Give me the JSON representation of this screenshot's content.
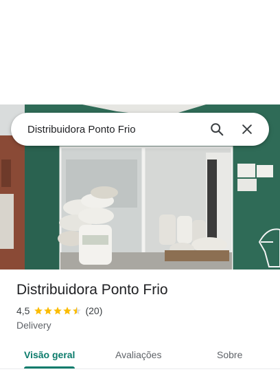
{
  "search": {
    "query": "Distribuidora Ponto Frio"
  },
  "place": {
    "name": "Distribuidora Ponto Frio",
    "rating": "4,5",
    "rating_value": 4.5,
    "reviews": "(20)",
    "category": "Delivery"
  },
  "tabs": [
    {
      "label": "Visão geral",
      "active": true
    },
    {
      "label": "Avaliações",
      "active": false
    },
    {
      "label": "Sobre",
      "active": false
    }
  ],
  "colors": {
    "accent": "#0b7b6b",
    "star": "#fbbc04",
    "storefront": "#2f6b57"
  },
  "icons": {
    "search": "search-icon",
    "close": "close-icon",
    "star": "star-icon"
  }
}
